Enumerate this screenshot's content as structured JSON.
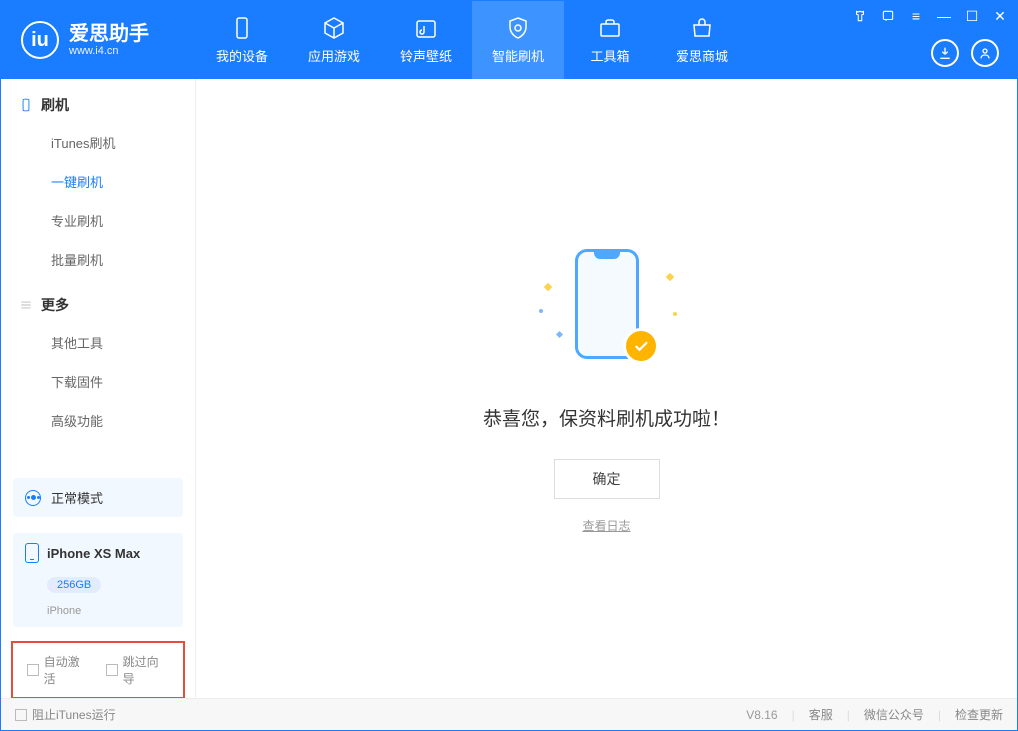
{
  "app": {
    "title": "爱思助手",
    "subtitle": "www.i4.cn"
  },
  "nav": {
    "tabs": [
      {
        "label": "我的设备"
      },
      {
        "label": "应用游戏"
      },
      {
        "label": "铃声壁纸"
      },
      {
        "label": "智能刷机"
      },
      {
        "label": "工具箱"
      },
      {
        "label": "爱思商城"
      }
    ]
  },
  "sidebar": {
    "group1_label": "刷机",
    "items1": [
      {
        "label": "iTunes刷机"
      },
      {
        "label": "一键刷机"
      },
      {
        "label": "专业刷机"
      },
      {
        "label": "批量刷机"
      }
    ],
    "group2_label": "更多",
    "items2": [
      {
        "label": "其他工具"
      },
      {
        "label": "下载固件"
      },
      {
        "label": "高级功能"
      }
    ],
    "mode_label": "正常模式",
    "device_name": "iPhone XS Max",
    "device_capacity": "256GB",
    "device_type": "iPhone",
    "chk_auto_activate": "自动激活",
    "chk_skip_guide": "跳过向导"
  },
  "main": {
    "success_text": "恭喜您，保资料刷机成功啦！",
    "ok_button": "确定",
    "view_log": "查看日志"
  },
  "footer": {
    "block_itunes": "阻止iTunes运行",
    "version": "V8.16",
    "link_support": "客服",
    "link_wechat": "微信公众号",
    "link_update": "检查更新"
  }
}
